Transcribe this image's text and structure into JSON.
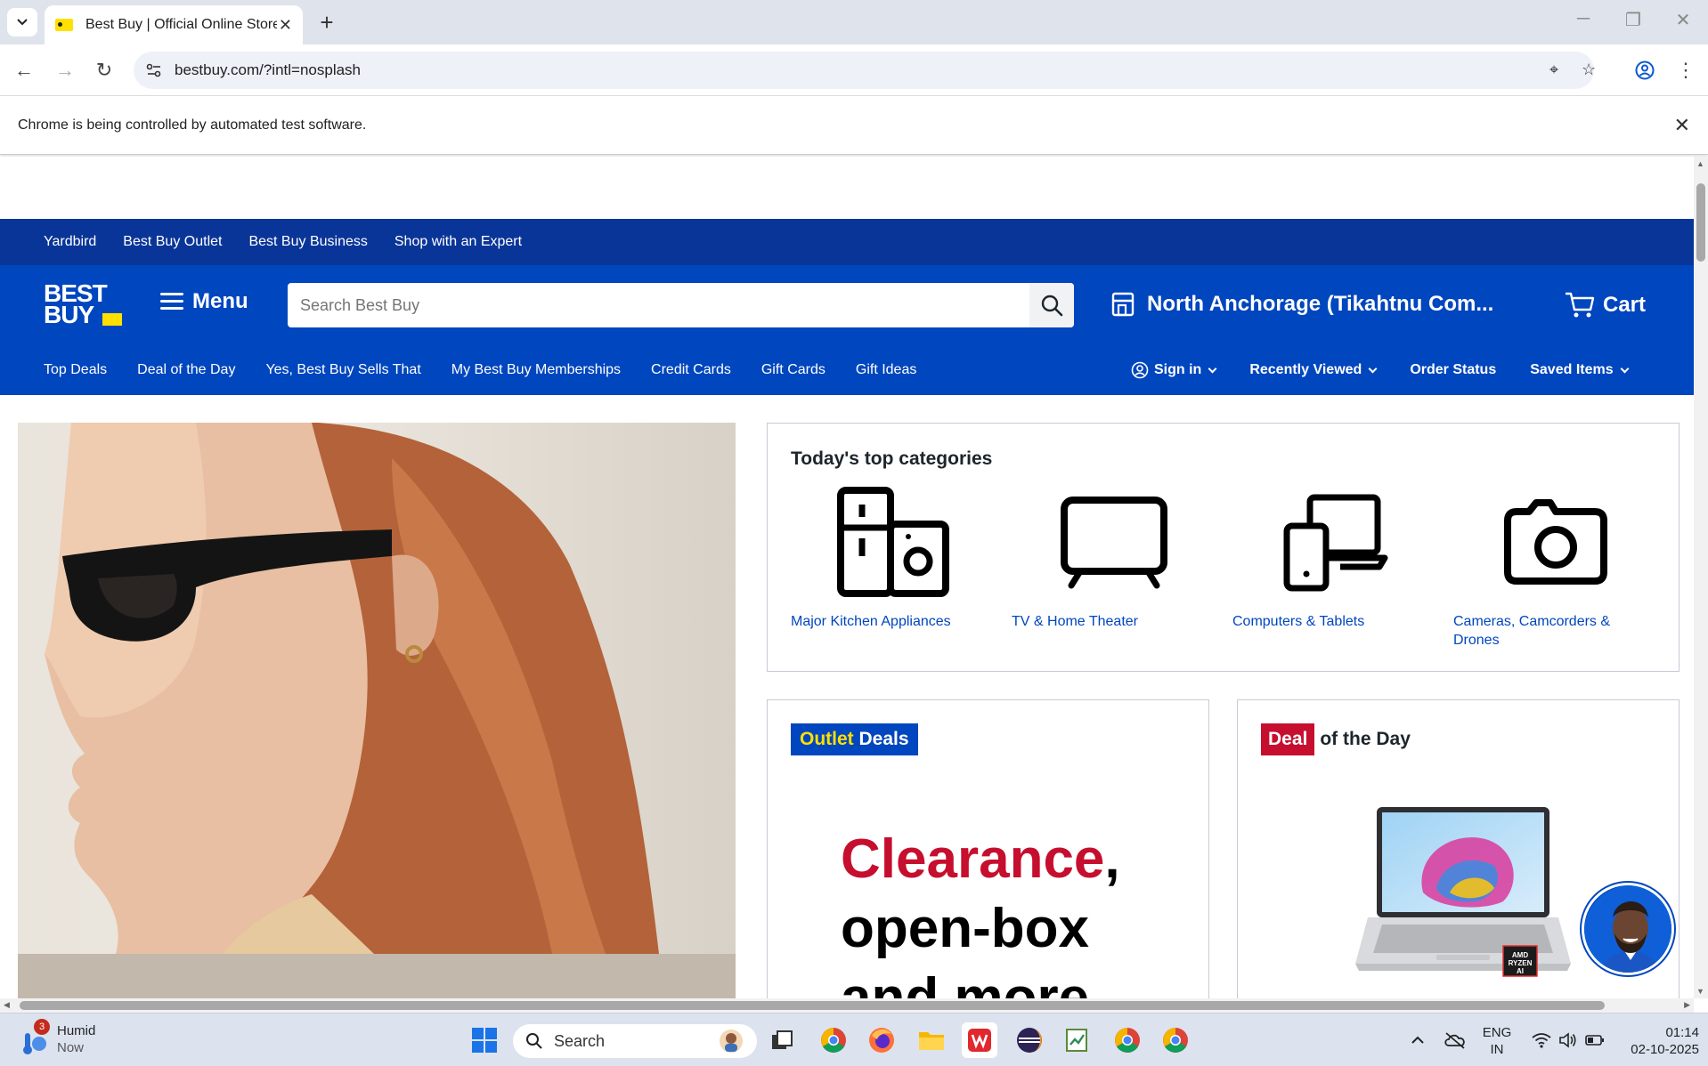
{
  "browser": {
    "tab_title": "Best Buy | Official Online Store |",
    "url": "bestbuy.com/?intl=nosplash",
    "infobar_text": "Chrome is being controlled by automated test software."
  },
  "topnav": {
    "links": [
      "Yardbird",
      "Best Buy Outlet",
      "Best Buy Business",
      "Shop with an Expert"
    ]
  },
  "header": {
    "logo_line1": "BEST",
    "logo_line2": "BUY",
    "menu_label": "Menu",
    "search_placeholder": "Search Best Buy",
    "store_name": "North Anchorage (Tikahtnu Com...",
    "cart_label": "Cart"
  },
  "secnav": {
    "left": [
      "Top Deals",
      "Deal of the Day",
      "Yes, Best Buy Sells That",
      "My Best Buy Memberships",
      "Credit Cards",
      "Gift Cards",
      "Gift Ideas"
    ],
    "sign_in": "Sign in",
    "recently_viewed": "Recently Viewed",
    "order_status": "Order Status",
    "saved_items": "Saved Items"
  },
  "categories": {
    "title": "Today's top categories",
    "items": [
      {
        "label": "Major Kitchen Appliances",
        "icon": "appliances-icon"
      },
      {
        "label": "TV & Home Theater",
        "icon": "tv-icon"
      },
      {
        "label": "Computers & Tablets",
        "icon": "computer-tablet-icon"
      },
      {
        "label": "Cameras, Camcorders & Drones",
        "icon": "camera-icon"
      }
    ]
  },
  "outlet": {
    "badge_word1": "Outlet",
    "badge_word2": "Deals",
    "headline_red": "Clearance",
    "headline_rest1": ",",
    "headline_line2": "open-box",
    "headline_line3": "and more"
  },
  "deal": {
    "badge_red": "Deal",
    "badge_rest": "of the Day",
    "chip_label": "AMD RYZEN AI"
  },
  "taskbar": {
    "weather_title": "Humid",
    "weather_sub": "Now",
    "weather_badge": "3",
    "search_label": "Search",
    "lang_line1": "ENG",
    "lang_line2": "IN",
    "time": "01:14",
    "date": "02-10-2025"
  },
  "colors": {
    "brand_blue": "#0046be",
    "dark_blue": "#0a3598",
    "brand_yellow": "#ffe000",
    "deal_red": "#c60e2e"
  }
}
